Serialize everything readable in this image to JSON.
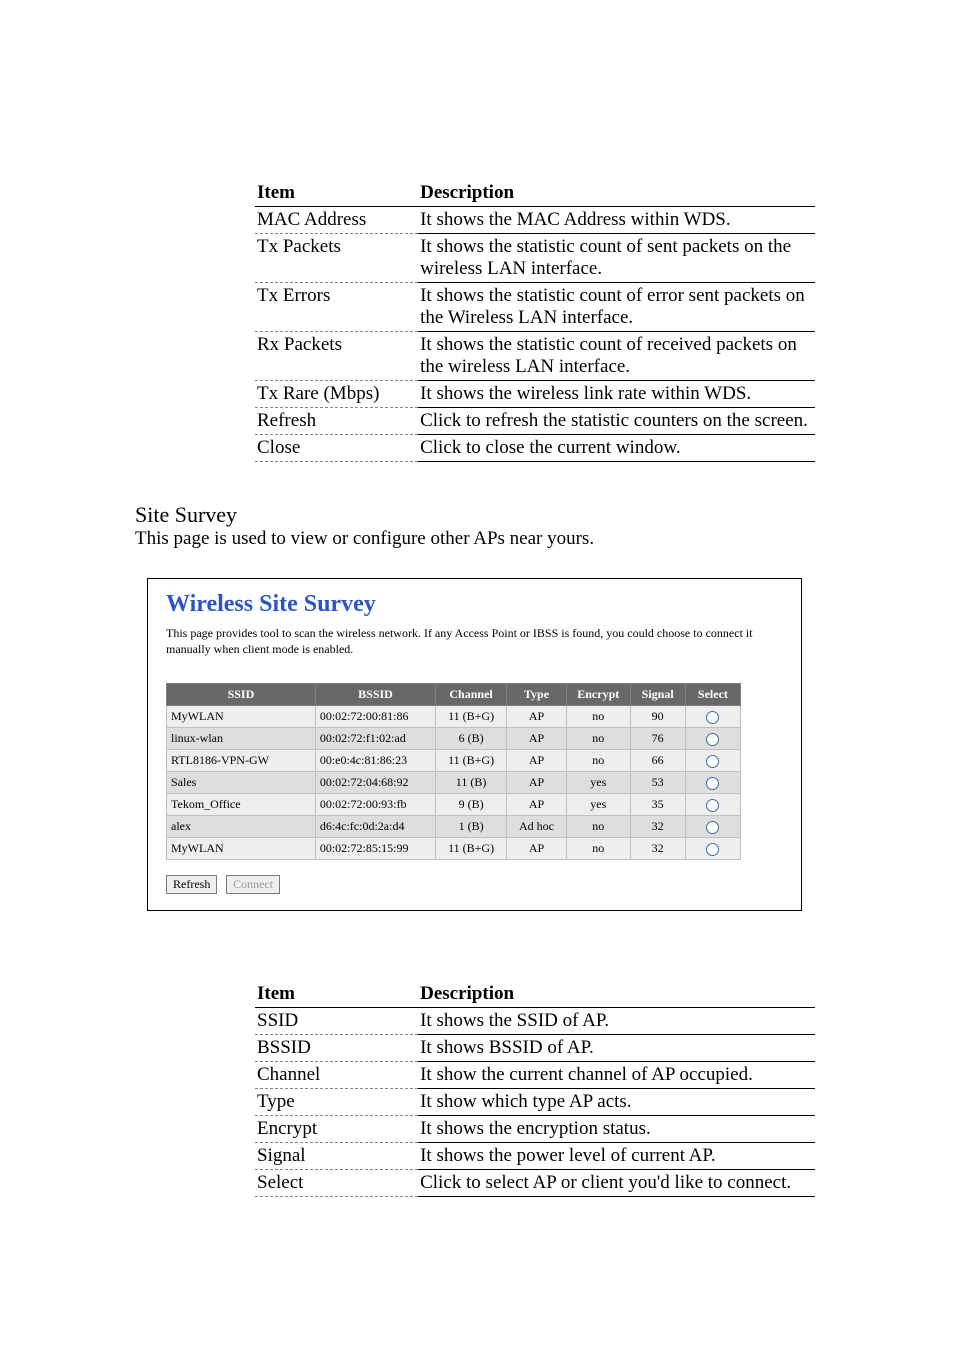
{
  "table1": {
    "headers": {
      "item": "Item",
      "desc": "Description"
    },
    "rows": [
      {
        "item": "MAC Address",
        "desc": "It shows the MAC Address within WDS."
      },
      {
        "item": "Tx Packets",
        "desc": "It shows the statistic count of sent packets on the wireless LAN interface."
      },
      {
        "item": "Tx Errors",
        "desc": "It shows the statistic count of error sent packets on the Wireless LAN interface."
      },
      {
        "item": "Rx Packets",
        "desc": "It shows the statistic count of received packets on the wireless LAN interface."
      },
      {
        "item": "Tx Rare (Mbps)",
        "desc": "It shows the wireless link rate within WDS."
      },
      {
        "item": "Refresh",
        "desc": "Click to refresh the statistic counters on the screen."
      },
      {
        "item": "Close",
        "desc": "Click to close the current window."
      }
    ]
  },
  "section": {
    "heading": "Site Survey",
    "sub": "This page is used to view or configure other APs near yours."
  },
  "survey": {
    "title": "Wireless Site Survey",
    "blurb": "This page provides tool to scan the wireless network. If any Access Point or IBSS is found, you could choose to connect it manually when client mode is enabled.",
    "cols": {
      "ssid": "SSID",
      "bssid": "BSSID",
      "channel": "Channel",
      "type": "Type",
      "encrypt": "Encrypt",
      "signal": "Signal",
      "select": "Select"
    },
    "rows": [
      {
        "ssid": "MyWLAN",
        "bssid": "00:02:72:00:81:86",
        "channel": "11 (B+G)",
        "type": "AP",
        "encrypt": "no",
        "signal": "90"
      },
      {
        "ssid": "linux-wlan",
        "bssid": "00:02:72:f1:02:ad",
        "channel": "6 (B)",
        "type": "AP",
        "encrypt": "no",
        "signal": "76"
      },
      {
        "ssid": "RTL8186-VPN-GW",
        "bssid": "00:e0:4c:81:86:23",
        "channel": "11 (B+G)",
        "type": "AP",
        "encrypt": "no",
        "signal": "66"
      },
      {
        "ssid": "Sales",
        "bssid": "00:02:72:04:68:92",
        "channel": "11 (B)",
        "type": "AP",
        "encrypt": "yes",
        "signal": "53"
      },
      {
        "ssid": "Tekom_Office",
        "bssid": "00:02:72:00:93:fb",
        "channel": "9 (B)",
        "type": "AP",
        "encrypt": "yes",
        "signal": "35"
      },
      {
        "ssid": "alex",
        "bssid": "d6:4c:fc:0d:2a:d4",
        "channel": "1 (B)",
        "type": "Ad hoc",
        "encrypt": "no",
        "signal": "32"
      },
      {
        "ssid": "MyWLAN",
        "bssid": "00:02:72:85:15:99",
        "channel": "11 (B+G)",
        "type": "AP",
        "encrypt": "no",
        "signal": "32"
      }
    ],
    "buttons": {
      "refresh": "Refresh",
      "connect": "Connect"
    }
  },
  "table2": {
    "headers": {
      "item": "Item",
      "desc": "Description"
    },
    "rows": [
      {
        "item": "SSID",
        "desc": "It shows the SSID of AP."
      },
      {
        "item": "BSSID",
        "desc": "It shows BSSID of AP."
      },
      {
        "item": "Channel",
        "desc": "It show the current channel of AP occupied."
      },
      {
        "item": "Type",
        "desc": "It show which type AP acts."
      },
      {
        "item": "Encrypt",
        "desc": "It shows the encryption status."
      },
      {
        "item": "Signal",
        "desc": "It shows the power level of current AP."
      },
      {
        "item": "Select",
        "desc": "Click to select AP or client you'd like to connect."
      }
    ]
  }
}
